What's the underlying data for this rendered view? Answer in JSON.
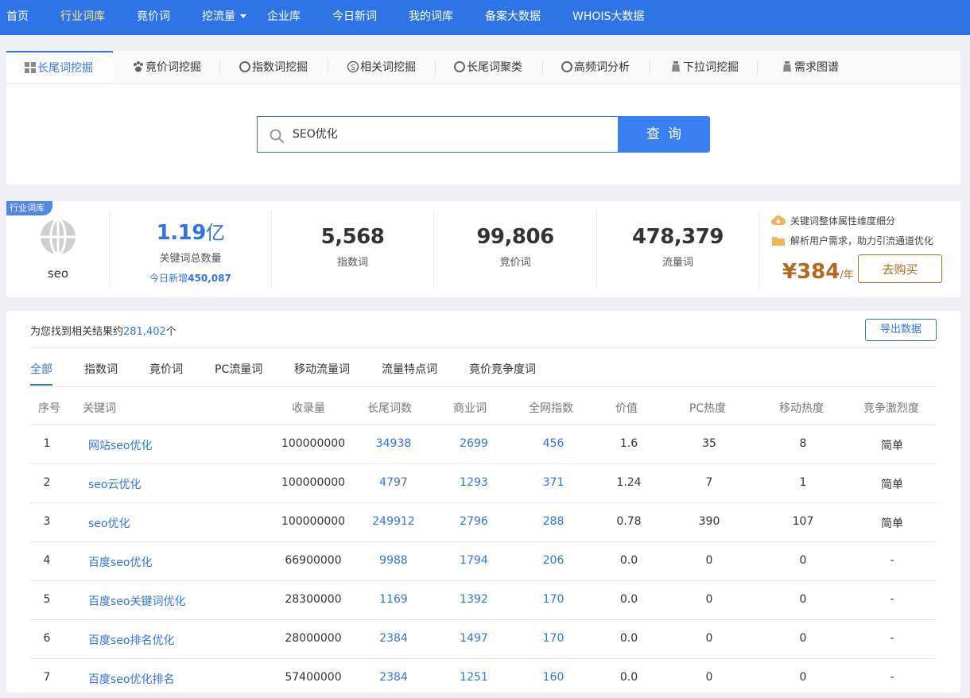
{
  "nav": {
    "items": [
      "首页",
      "行业词库",
      "竟价词",
      "挖流量",
      "企业库",
      "今日新词",
      "我的词库",
      "备案大数据",
      "WHOIS大数据"
    ]
  },
  "tools": {
    "tabs": [
      "长尾词挖掘",
      "竟价词挖掘",
      "指数词挖掘",
      "相关词挖掘",
      "长尾词聚类",
      "高频词分析",
      "下拉词挖掘",
      "需求图谱"
    ]
  },
  "search": {
    "value": "SEO优化",
    "button": "查询"
  },
  "stats": {
    "tag": "行业词库",
    "keyword": "seo",
    "total_value": "1.19",
    "total_unit": "亿",
    "total_label": "关键词总数量",
    "today_prefix": "今日新增",
    "today_value": "450,087",
    "index_value": "5,568",
    "index_label": "指数词",
    "bid_value": "99,806",
    "bid_label": "竞价词",
    "traffic_value": "478,379",
    "traffic_label": "流量词",
    "promo1": "关键词整体属性维度细分",
    "promo2": "解析用户需求，助力引流通道优化",
    "price": "¥384",
    "price_unit": "/年",
    "buy_label": "去购买"
  },
  "results": {
    "count_prefix": "为您找到相关结果约",
    "count": "281,402",
    "count_suffix": "个",
    "export_label": "导出数据",
    "filters": [
      "全部",
      "指数词",
      "竟价词",
      "PC流量词",
      "移动流量词",
      "流量特点词",
      "竟价竞争度词"
    ],
    "columns": [
      "序号",
      "关键词",
      "收录量",
      "长尾词数",
      "商业词",
      "全网指数",
      "价值",
      "PC热度",
      "移动热度",
      "竞争激烈度"
    ],
    "rows": [
      [
        "1",
        "网站seo优化",
        "100000000",
        "34938",
        "2699",
        "456",
        "1.6",
        "35",
        "8",
        "简单"
      ],
      [
        "2",
        "seo云优化",
        "100000000",
        "4797",
        "1293",
        "371",
        "1.24",
        "7",
        "1",
        "简单"
      ],
      [
        "3",
        "seo优化",
        "100000000",
        "249912",
        "2796",
        "288",
        "0.78",
        "390",
        "107",
        "简单"
      ],
      [
        "4",
        "百度seo优化",
        "66900000",
        "9988",
        "1794",
        "206",
        "0.0",
        "0",
        "0",
        "-"
      ],
      [
        "5",
        "百度seo关键词优化",
        "28300000",
        "1169",
        "1392",
        "170",
        "0.0",
        "0",
        "0",
        "-"
      ],
      [
        "6",
        "百度seo排名优化",
        "28000000",
        "2384",
        "1497",
        "170",
        "0.0",
        "0",
        "0",
        "-"
      ],
      [
        "7",
        "百度seo优化排名",
        "57400000",
        "2384",
        "1251",
        "160",
        "0.0",
        "0",
        "0",
        "-"
      ]
    ]
  },
  "colors": {
    "nav_bg": "#2f74e6",
    "nav_active": "#ffe97a",
    "link": "#2f74e6",
    "price": "#b5691c"
  }
}
